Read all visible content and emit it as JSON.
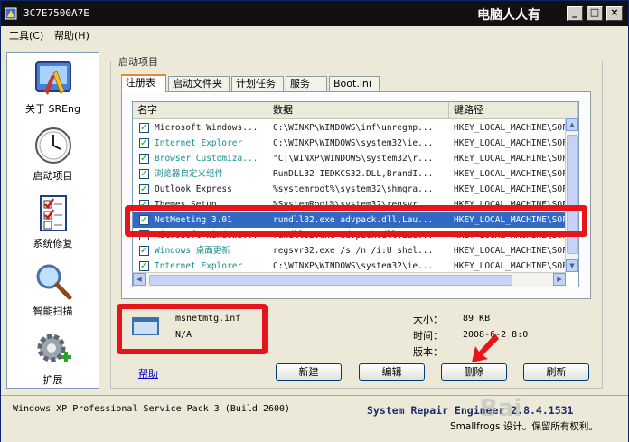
{
  "window": {
    "title": "3C7E7500A7E",
    "brand": "电脑人人有",
    "controls": [
      "_",
      "□",
      "×"
    ]
  },
  "menu": [
    "工具(C)",
    "帮助(H)"
  ],
  "sidebar": {
    "items": [
      {
        "label": "关于 SREng",
        "icon": "tools-icon"
      },
      {
        "label": "启动项目",
        "icon": "clock-icon"
      },
      {
        "label": "系统修复",
        "icon": "checklist-icon"
      },
      {
        "label": "智能扫描",
        "icon": "magnifier-icon"
      },
      {
        "label": "扩展",
        "icon": "gear-plus-icon"
      }
    ]
  },
  "group_title": "启动项目",
  "tabs": [
    "注册表",
    "启动文件夹",
    "计划任务",
    "服务",
    "Boot.ini"
  ],
  "active_tab": "注册表",
  "list": {
    "columns": [
      "名字",
      "数据",
      "键路径"
    ],
    "rows": [
      {
        "name": "Microsoft Windows...",
        "data": "C:\\WINXP\\WINDOWS\\inf\\unregmp...",
        "key": "HKEY_LOCAL_MACHINE\\SOFT",
        "color": "#1a1a1a"
      },
      {
        "name": "Internet Explorer",
        "data": "C:\\WINXP\\WINDOWS\\system32\\ie...",
        "key": "HKEY_LOCAL_MACHINE\\SOFT",
        "color": "#1d8d8d"
      },
      {
        "name": "Browser Customiza...",
        "data": "\"C:\\WINXP\\WINDOWS\\system32\\r...",
        "key": "HKEY_LOCAL_MACHINE\\SOFT",
        "color": "#1d8d8d"
      },
      {
        "name": "浏览器自定义组件",
        "data": "RunDLL32 IEDKCS32.DLL,BrandI...",
        "key": "HKEY_LOCAL_MACHINE\\SOFT",
        "color": "#1d8d8d"
      },
      {
        "name": "Outlook Express",
        "data": "%systemroot%\\system32\\shmgra...",
        "key": "HKEY_LOCAL_MACHINE\\SOFT",
        "color": "#1a1a1a"
      },
      {
        "name": "Themes Setup",
        "data": "%SystemRoot%\\system32\\regsvr...",
        "key": "HKEY_LOCAL_MACHINE\\SOFT",
        "color": "#1a1a1a"
      },
      {
        "name": "NetMeeting 3.01",
        "data": "rundll32.exe advpack.dll,Lau...",
        "key": "HKEY_LOCAL_MACHINE\\SOFT",
        "color": "#ffffff",
        "selected": true
      },
      {
        "name": "Microsoft Windows...",
        "data": "rundll32.exe advpack.dll,Lau...",
        "key": "HKEY_LOCAL_MACHINE\\SOFT",
        "color": "#1a1a1a"
      },
      {
        "name": "Windows 桌面更新",
        "data": "regsvr32.exe /s /n /i:U shel...",
        "key": "HKEY_LOCAL_MACHINE\\SOFT",
        "color": "#1d8d8d"
      },
      {
        "name": "Internet Explorer",
        "data": "C:\\WINXP\\WINDOWS\\system32\\ie...",
        "key": "HKEY_LOCAL_MACHINE\\SOFT",
        "color": "#1d8d8d"
      }
    ]
  },
  "detail": {
    "file": "msnetmtg.inf",
    "company": "N/A",
    "size_label": "大小：",
    "size_value": "89 KB",
    "time_label": "时间：",
    "time_value": "2008-6-2 8:0",
    "version_label": "版本：",
    "version_value": ""
  },
  "buttons": {
    "help": "帮助",
    "new": "新建",
    "edit": "编辑",
    "delete": "删除",
    "refresh": "刷新"
  },
  "status": {
    "os": "Windows XP Professional Service Pack 3 (Build 2600)",
    "product": "System Repair Engineer 2.8.4.1531",
    "copyright": "Smallfrogs 设计。保留所有权利。"
  },
  "watermark": "Bai",
  "colors": {
    "annotation": "#e8141b",
    "selection": "#316ac5",
    "title_bar": "#111111"
  }
}
